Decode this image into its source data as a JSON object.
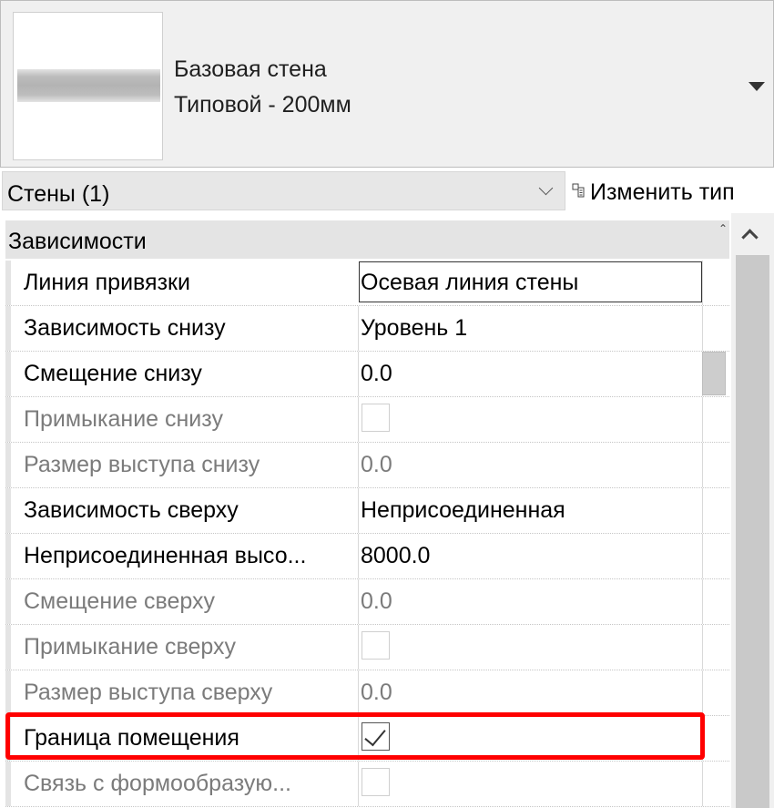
{
  "type_selector": {
    "family": "Базовая стена",
    "type": "Типовой - 200мм"
  },
  "filter": {
    "selection": "Стены (1)",
    "edit_type_label": "Изменить тип"
  },
  "section": {
    "title": "Зависимости"
  },
  "properties": [
    {
      "label": "Линия привязки",
      "value": "Осевая линия стены",
      "kind": "text",
      "enabled": true
    },
    {
      "label": "Зависимость снизу",
      "value": "Уровень 1",
      "kind": "text",
      "enabled": true
    },
    {
      "label": "Смещение снизу",
      "value": "0.0",
      "kind": "text",
      "enabled": true
    },
    {
      "label": "Примыкание снизу",
      "value": "",
      "kind": "checkbox",
      "checked": false,
      "enabled": false
    },
    {
      "label": "Размер выступа снизу",
      "value": "0.0",
      "kind": "text",
      "enabled": false
    },
    {
      "label": "Зависимость сверху",
      "value": "Неприсоединенная",
      "kind": "text",
      "enabled": true
    },
    {
      "label": "Неприсоединенная высо...",
      "value": "8000.0",
      "kind": "text",
      "enabled": true
    },
    {
      "label": "Смещение сверху",
      "value": "0.0",
      "kind": "text",
      "enabled": false
    },
    {
      "label": "Примыкание сверху",
      "value": "",
      "kind": "checkbox",
      "checked": false,
      "enabled": false
    },
    {
      "label": "Размер выступа сверху",
      "value": "0.0",
      "kind": "text",
      "enabled": false
    },
    {
      "label": "Граница помещения",
      "value": "",
      "kind": "checkbox",
      "checked": true,
      "enabled": true
    },
    {
      "label": "Связь с формообразую...",
      "value": "",
      "kind": "checkbox",
      "checked": false,
      "enabled": false
    }
  ],
  "colors": {
    "highlight": "#ff0000",
    "disabled_text": "#7b7b7b",
    "section_bg": "#e4e4e4"
  }
}
